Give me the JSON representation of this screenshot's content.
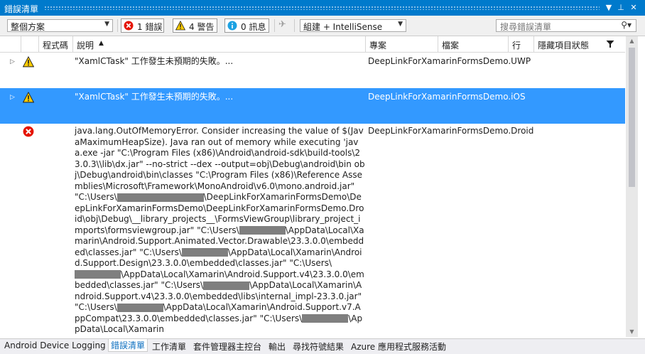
{
  "window": {
    "title": "錯誤清單",
    "buttons": {
      "dropdown": "▼",
      "pin": "⊥",
      "close": "✕"
    }
  },
  "toolbar": {
    "scope_value": "整個方案",
    "errors_label": "1 錯誤",
    "warnings_label": "4 警告",
    "messages_label": "0 訊息",
    "filter_source_value": "組建 + IntelliSense",
    "search_placeholder": "搜尋錯誤清單"
  },
  "columns": {
    "code": "程式碼",
    "description": "說明",
    "sort_indicator": "▲",
    "project": "專案",
    "file": "檔案",
    "line": "行",
    "suppression": "隱藏項目狀態"
  },
  "rows": [
    {
      "severity": "warning",
      "description": "\"XamlCTask\" 工作發生未預期的失敗。...",
      "project": "DeepLinkForXamarinFormsDemo.UWP",
      "selected": false
    },
    {
      "severity": "warning",
      "description": "\"XamlCTask\" 工作發生未預期的失敗。...",
      "project": "DeepLinkForXamarinFormsDemo.iOS",
      "selected": true
    },
    {
      "severity": "error",
      "project": "DeepLinkForXamarinFormsDemo.Droid",
      "selected": false,
      "description_parts": [
        "java.lang.OutOfMemoryError. Consider increasing the value of $(JavaMaximumHeapSize). Java ran out of memory while executing 'java.exe -jar \"C:\\Program Files (x86)\\Android\\android-sdk\\build-tools\\23.0.3\\\\lib\\dx.jar\" --no-strict --dex --output=obj\\Debug\\android\\bin obj\\Debug\\android\\bin\\classes \"C:\\Program Files (x86)\\Reference Assemblies\\Microsoft\\Framework\\MonoAndroid\\v6.0\\mono.android.jar\" \"C:\\Users\\",
        "\\DeepLinkForXamarinFormsDemo\\DeepLinkForXamarinFormsDemo\\DeepLinkForXamarinFormsDemo.Droid\\obj\\Debug\\__library_projects__\\FormsViewGroup\\library_project_imports\\formsviewgroup.jar\" \"C:\\Users\\",
        "\\AppData\\Local\\Xamarin\\Android.Support.Animated.Vector.Drawable\\23.3.0.0\\embedded\\classes.jar\" \"C:\\Users\\",
        "\\AppData\\Local\\Xamarin\\Android.Support.Design\\23.3.0.0\\embedded\\classes.jar\" \"C:\\Users\\",
        "\\AppData\\Local\\Xamarin\\Android.Support.v4\\23.3.0.0\\embedded\\classes.jar\" \"C:\\Users\\",
        "\\AppData\\Local\\Xamarin\\Android.Support.v4\\23.3.0.0\\embedded\\libs\\internal_impl-23.3.0.jar\" \"C:\\Users\\",
        "\\AppData\\Local\\Xamarin\\Android.Support.v7.AppCompat\\23.3.0.0\\embedded\\classes.jar\" \"C:\\Users\\",
        "\\AppData\\Local\\Xamarin"
      ]
    }
  ],
  "bottom_tabs": [
    {
      "label": "Android Device Logging",
      "active": false
    },
    {
      "label": "錯誤清單",
      "active": true
    },
    {
      "label": "工作清單",
      "active": false
    },
    {
      "label": "套件管理器主控台",
      "active": false
    },
    {
      "label": "輸出",
      "active": false
    },
    {
      "label": "尋找符號結果",
      "active": false
    },
    {
      "label": "Azure 應用程式服務活動",
      "active": false
    }
  ],
  "colors": {
    "title_bar": "#007acc",
    "selection": "#3399ff",
    "error_icon": "#e51400",
    "warning_icon": "#ffcc00",
    "info_icon": "#1ba1e2",
    "active_tab_text": "#0e70c0"
  }
}
